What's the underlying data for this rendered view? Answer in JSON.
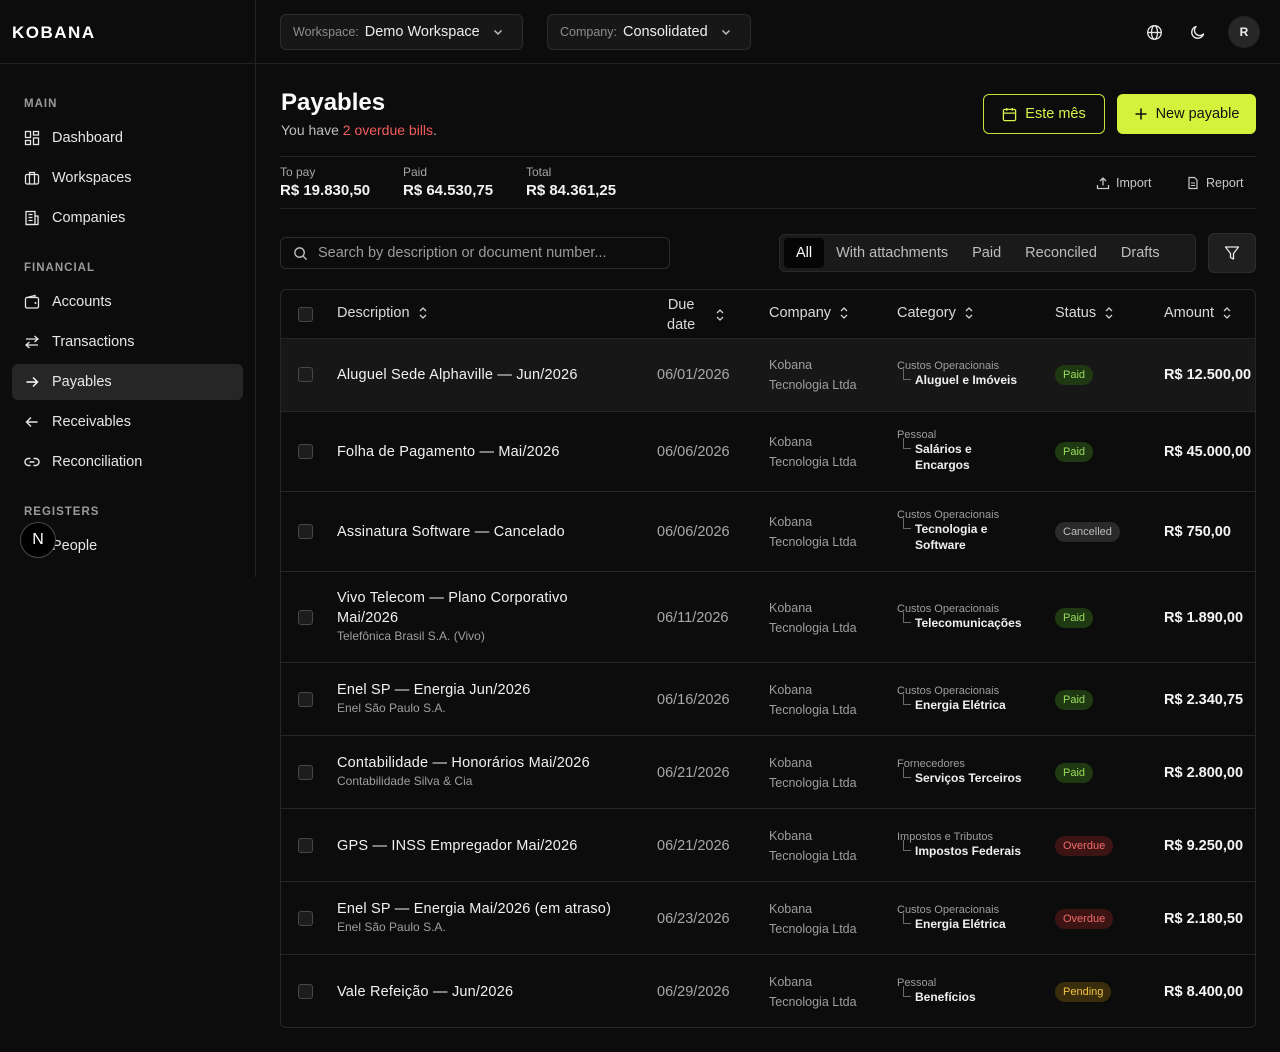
{
  "app": {
    "logo": "KOBANA"
  },
  "topbar": {
    "workspace": {
      "label": "Workspace:",
      "value": "Demo Workspace"
    },
    "company": {
      "label": "Company:",
      "value": "Consolidated"
    },
    "avatar": "R"
  },
  "sidebar": {
    "main_title": "MAIN",
    "financial_title": "FINANCIAL",
    "registers_title": "REGISTERS",
    "items": {
      "dashboard": "Dashboard",
      "workspaces": "Workspaces",
      "companies": "Companies",
      "accounts": "Accounts",
      "transactions": "Transactions",
      "payables": "Payables",
      "receivables": "Receivables",
      "reconciliation": "Reconciliation",
      "people": "People"
    },
    "badge": "N"
  },
  "header": {
    "title": "Payables",
    "subtitle_prefix": "You have ",
    "subtitle_highlight": "2 overdue bills",
    "subtitle_suffix": ".",
    "period_button": "Este mês",
    "new_button": "New payable"
  },
  "summary": {
    "to_pay_label": "To pay",
    "to_pay_value": "R$ 19.830,50",
    "paid_label": "Paid",
    "paid_value": "R$ 64.530,75",
    "total_label": "Total",
    "total_value": "R$ 84.361,25",
    "import": "Import",
    "report": "Report"
  },
  "search": {
    "placeholder": "Search by description or document number..."
  },
  "tabs": {
    "all": "All",
    "attachments": "With attachments",
    "paid": "Paid",
    "reconciled": "Reconciled",
    "drafts": "Drafts"
  },
  "table": {
    "headers": {
      "description": "Description",
      "due_line1": "Due",
      "due_line2": "date",
      "company": "Company",
      "category": "Category",
      "status": "Status",
      "amount": "Amount"
    },
    "rows": [
      {
        "desc": "Aluguel Sede Alphaville — Jun/2026",
        "due": "06/01/2026",
        "company1": "Kobana",
        "company2": "Tecnologia Ltda",
        "cat_parent": "Custos Operacionais",
        "cat_child": "Aluguel e Imóveis",
        "status": "Paid",
        "amount": "R$ 12.500,00"
      },
      {
        "desc": "Folha de Pagamento — Mai/2026",
        "due": "06/06/2026",
        "company1": "Kobana",
        "company2": "Tecnologia Ltda",
        "cat_parent": "Pessoal",
        "cat_child_1": "Salários e",
        "cat_child_2": "Encargos",
        "status": "Paid",
        "amount": "R$ 45.000,00"
      },
      {
        "desc": "Assinatura Software — Cancelado",
        "due": "06/06/2026",
        "company1": "Kobana",
        "company2": "Tecnologia Ltda",
        "cat_parent": "Custos Operacionais",
        "cat_child_1": "Tecnologia e",
        "cat_child_2": "Software",
        "status": "Cancelled",
        "amount": "R$ 750,00"
      },
      {
        "desc_1": "Vivo Telecom — Plano Corporativo",
        "desc_2": "Mai/2026",
        "sub": "Telefônica Brasil S.A. (Vivo)",
        "due": "06/11/2026",
        "company1": "Kobana",
        "company2": "Tecnologia Ltda",
        "cat_parent": "Custos Operacionais",
        "cat_child": "Telecomunicações",
        "status": "Paid",
        "amount": "R$ 1.890,00"
      },
      {
        "desc": "Enel SP — Energia Jun/2026",
        "sub": "Enel São Paulo S.A.",
        "due": "06/16/2026",
        "company1": "Kobana",
        "company2": "Tecnologia Ltda",
        "cat_parent": "Custos Operacionais",
        "cat_child": "Energia Elétrica",
        "status": "Paid",
        "amount": "R$ 2.340,75"
      },
      {
        "desc": "Contabilidade — Honorários Mai/2026",
        "sub": "Contabilidade Silva & Cia",
        "due": "06/21/2026",
        "company1": "Kobana",
        "company2": "Tecnologia Ltda",
        "cat_parent": "Fornecedores",
        "cat_child": "Serviços Terceiros",
        "status": "Paid",
        "amount": "R$ 2.800,00"
      },
      {
        "desc": "GPS — INSS Empregador Mai/2026",
        "due": "06/21/2026",
        "company1": "Kobana",
        "company2": "Tecnologia Ltda",
        "cat_parent": "Impostos e Tributos",
        "cat_child": "Impostos Federais",
        "status": "Overdue",
        "amount": "R$ 9.250,00"
      },
      {
        "desc": "Enel SP — Energia Mai/2026 (em atraso)",
        "sub": "Enel São Paulo S.A.",
        "due": "06/23/2026",
        "company1": "Kobana",
        "company2": "Tecnologia Ltda",
        "cat_parent": "Custos Operacionais",
        "cat_child": "Energia Elétrica",
        "status": "Overdue",
        "amount": "R$ 2.180,50"
      },
      {
        "desc": "Vale Refeição — Jun/2026",
        "due": "06/29/2026",
        "company1": "Kobana",
        "company2": "Tecnologia Ltda",
        "cat_parent": "Pessoal",
        "cat_child": "Benefícios",
        "status": "Pending",
        "amount": "R$ 8.400,00"
      }
    ]
  },
  "colors": {
    "accent": "#d4f23c",
    "paid": "#9adb5b",
    "overdue": "#f26a6a",
    "pending": "#f2c341",
    "background": "#0c0c0c"
  }
}
